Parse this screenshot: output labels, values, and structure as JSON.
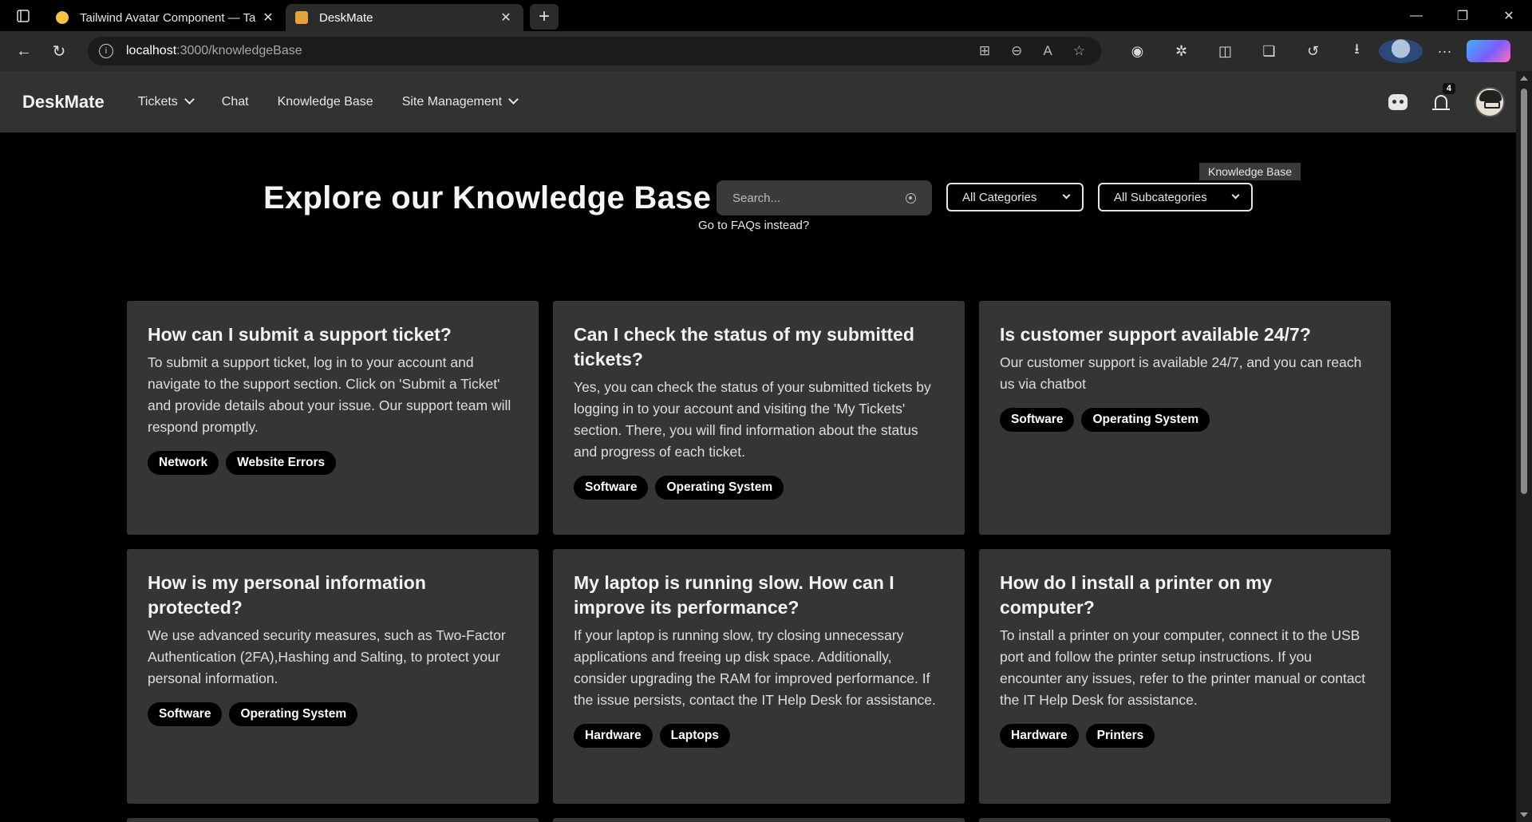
{
  "browser": {
    "tabs": [
      {
        "title": "Tailwind Avatar Component — Ta",
        "favicon_color": "#f5c542",
        "active": false
      },
      {
        "title": "DeskMate",
        "favicon_color": "#e8a23a",
        "active": true
      }
    ],
    "url_host": "localhost",
    "url_path": ":3000/knowledgeBase",
    "profile_color": "#2b4a7a"
  },
  "nav": {
    "brand": "DeskMate",
    "links": [
      {
        "label": "Tickets",
        "dropdown": true
      },
      {
        "label": "Chat",
        "dropdown": false
      },
      {
        "label": "Knowledge Base",
        "dropdown": false
      },
      {
        "label": "Site Management",
        "dropdown": true
      }
    ],
    "notification_count": "4"
  },
  "hero": {
    "title": "Explore our Knowledge Base",
    "search_placeholder": "Search...",
    "faq_link": "Go to FAQs instead?",
    "category_select": "All Categories",
    "subcategory_select": "All Subcategories",
    "tooltip": "Knowledge Base"
  },
  "cards": [
    {
      "title": "How can I submit a support ticket?",
      "body": "To submit a support ticket, log in to your account and navigate to the support section. Click on 'Submit a Ticket' and provide details about your issue. Our support team will respond promptly.",
      "tags": [
        "Network",
        "Website Errors"
      ]
    },
    {
      "title": "Can I check the status of my submitted tickets?",
      "body": "Yes, you can check the status of your submitted tickets by logging in to your account and visiting the 'My Tickets' section. There, you will find information about the status and progress of each ticket.",
      "tags": [
        "Software",
        "Operating System"
      ]
    },
    {
      "title": "Is customer support available 24/7?",
      "body": "Our customer support is available 24/7, and you can reach us via chatbot",
      "tags": [
        "Software",
        "Operating System"
      ]
    },
    {
      "title": "How is my personal information protected?",
      "body": "We use advanced security measures, such as Two-Factor Authentication (2FA),Hashing and Salting, to protect your personal information.",
      "tags": [
        "Software",
        "Operating System"
      ]
    },
    {
      "title": "My laptop is running slow. How can I improve its performance?",
      "body": "If your laptop is running slow, try closing unnecessary applications and freeing up disk space. Additionally, consider upgrading the RAM for improved performance. If the issue persists, contact the IT Help Desk for assistance.",
      "tags": [
        "Hardware",
        "Laptops"
      ]
    },
    {
      "title": "How do I install a printer on my computer?",
      "body": "To install a printer on your computer, connect it to the USB port and follow the printer setup instructions. If you encounter any issues, refer to the printer manual or contact the IT Help Desk for assistance.",
      "tags": [
        "Hardware",
        "Printers"
      ]
    }
  ]
}
